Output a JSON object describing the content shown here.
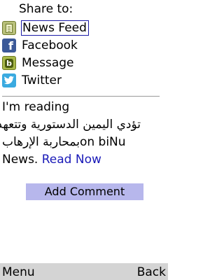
{
  "share": {
    "title": "Share to:",
    "options": [
      {
        "label": "News Feed",
        "icon": "news-feed-icon",
        "selected": true
      },
      {
        "label": "Facebook",
        "icon": "facebook-icon",
        "selected": false
      },
      {
        "label": "Message",
        "icon": "message-icon",
        "selected": false
      },
      {
        "label": "Twitter",
        "icon": "twitter-icon",
        "selected": false
      }
    ]
  },
  "message": {
    "line1": "I'm reading",
    "line2": "تؤدي اليمين الدستورية وتتعهد",
    "line3_prefix": "بمحاربة الإرهاب",
    "line3_suffix": "on biNu",
    "line4_text": "News.",
    "link": "Read Now"
  },
  "actions": {
    "add_comment": "Add Comment"
  },
  "softkeys": {
    "left": "Menu",
    "right": "Back"
  },
  "colors": {
    "selection_border": "#1a1aa6",
    "link": "#1a1ab8",
    "button_bg": "#b7b7ec",
    "softkey_bar": "#d4d4d4",
    "facebook": "#3b5998",
    "twitter": "#3aaae0"
  }
}
